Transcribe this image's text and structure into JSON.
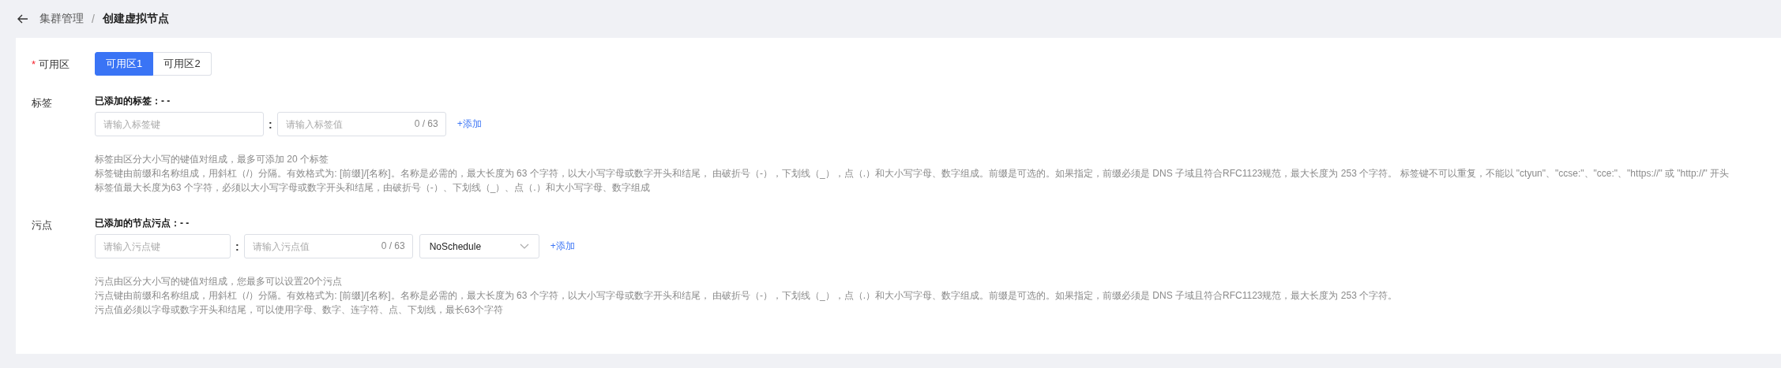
{
  "breadcrumb": {
    "items": [
      {
        "label": "集群管理",
        "current": false
      },
      {
        "label": "创建虚拟节点",
        "current": true
      }
    ],
    "separator": "/"
  },
  "zone": {
    "label": "可用区",
    "required_mark": "*",
    "options": [
      {
        "label": "可用区1",
        "selected": true
      },
      {
        "label": "可用区2",
        "selected": false
      }
    ]
  },
  "sections": [
    {
      "kind": "labels",
      "label": "标签",
      "added_title": "已添加的标签：- -",
      "key_input": {
        "placeholder": "请输入标签键"
      },
      "separator": ":",
      "value_input": {
        "placeholder": "请输入标签值",
        "counter": "0 / 63"
      },
      "add_link": "+添加",
      "hints": [
        "标签由区分大小写的键值对组成，最多可添加 20 个标签",
        "标签键由前缀和名称组成，用斜杠（/）分隔。有效格式为: [前缀]/[名称]。名称是必需的，最大长度为 63 个字符，以大小写字母或数字开头和结尾， 由破折号（-），下划线（_），点（.）和大小写字母、数字组成。前缀是可选的。如果指定，前缀必须是 DNS 子域且符合RFC1123规范，最大长度为 253 个字符。 标签键不可以重复，不能以 \"ctyun\"、\"ccse:\"、\"cce:\"、\"https://\" 或 \"http://\" 开头",
        "标签值最大长度为63 个字符，必须以大小写字母或数字开头和结尾，由破折号（-）、下划线（_）、点（.）和大小写字母、数字组成"
      ]
    },
    {
      "kind": "taints",
      "label": "污点",
      "added_title": "已添加的节点污点：- -",
      "key_input": {
        "placeholder": "请输入污点键"
      },
      "separator": ":",
      "value_input": {
        "placeholder": "请输入污点值",
        "counter": "0 / 63"
      },
      "select": {
        "value": "NoSchedule"
      },
      "add_link": "+添加",
      "hints": [
        "污点由区分大小写的键值对组成，您最多可以设置20个污点",
        "污点键由前缀和名称组成，用斜杠（/）分隔。有效格式为: [前缀]/[名称]。名称是必需的，最大长度为 63 个字符，以大小写字母或数字开头和结尾， 由破折号（-），下划线（_），点（.）和大小写字母、数字组成。前缀是可选的。如果指定，前缀必须是 DNS 子域且符合RFC1123规范，最大长度为 253 个字符。",
        "污点值必须以字母或数字开头和结尾，可以使用字母、数字、连字符、点、下划线，最长63个字符"
      ]
    }
  ]
}
